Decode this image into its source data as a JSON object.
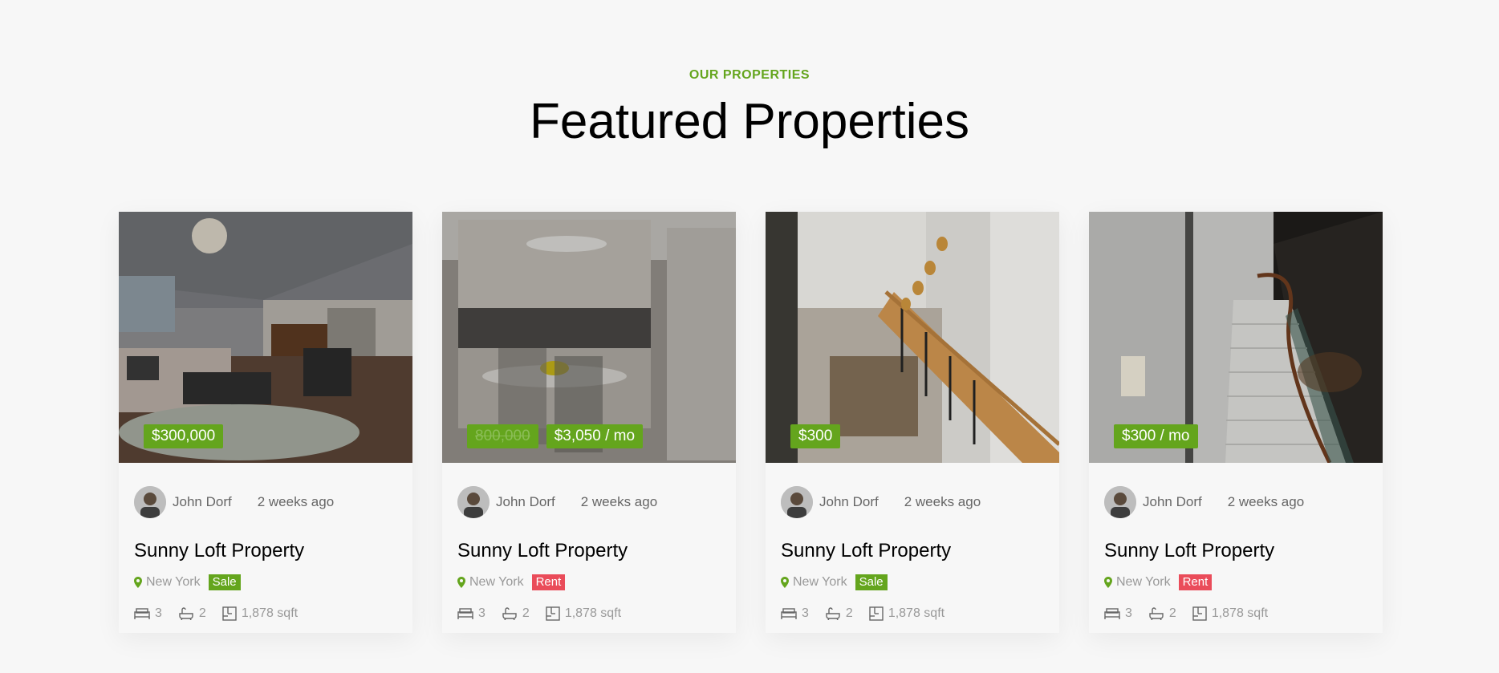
{
  "section": {
    "eyebrow": "OUR PROPERTIES",
    "title": "Featured Properties"
  },
  "colors": {
    "accent": "#64a51d",
    "rent": "#ea4c5a"
  },
  "cards": [
    {
      "image": "living-room-photo",
      "old_price": "",
      "price": "$300,000",
      "author": "John Dorf",
      "time": "2 weeks ago",
      "title": "Sunny Loft Property",
      "location": "New York",
      "tag": "Sale",
      "beds": "3",
      "baths": "2",
      "area": "1,878 sqft"
    },
    {
      "image": "kitchen-photo",
      "old_price": "800,000",
      "price": "$3,050 / mo",
      "author": "John Dorf",
      "time": "2 weeks ago",
      "title": "Sunny Loft Property",
      "location": "New York",
      "tag": "Rent",
      "beds": "3",
      "baths": "2",
      "area": "1,878 sqft"
    },
    {
      "image": "staircase-photo",
      "old_price": "",
      "price": "$300",
      "author": "John Dorf",
      "time": "2 weeks ago",
      "title": "Sunny Loft Property",
      "location": "New York",
      "tag": "Sale",
      "beds": "3",
      "baths": "2",
      "area": "1,878 sqft"
    },
    {
      "image": "grand-stairs-photo",
      "old_price": "",
      "price": "$300 / mo",
      "author": "John Dorf",
      "time": "2 weeks ago",
      "title": "Sunny Loft Property",
      "location": "New York",
      "tag": "Rent",
      "beds": "3",
      "baths": "2",
      "area": "1,878 sqft"
    }
  ]
}
